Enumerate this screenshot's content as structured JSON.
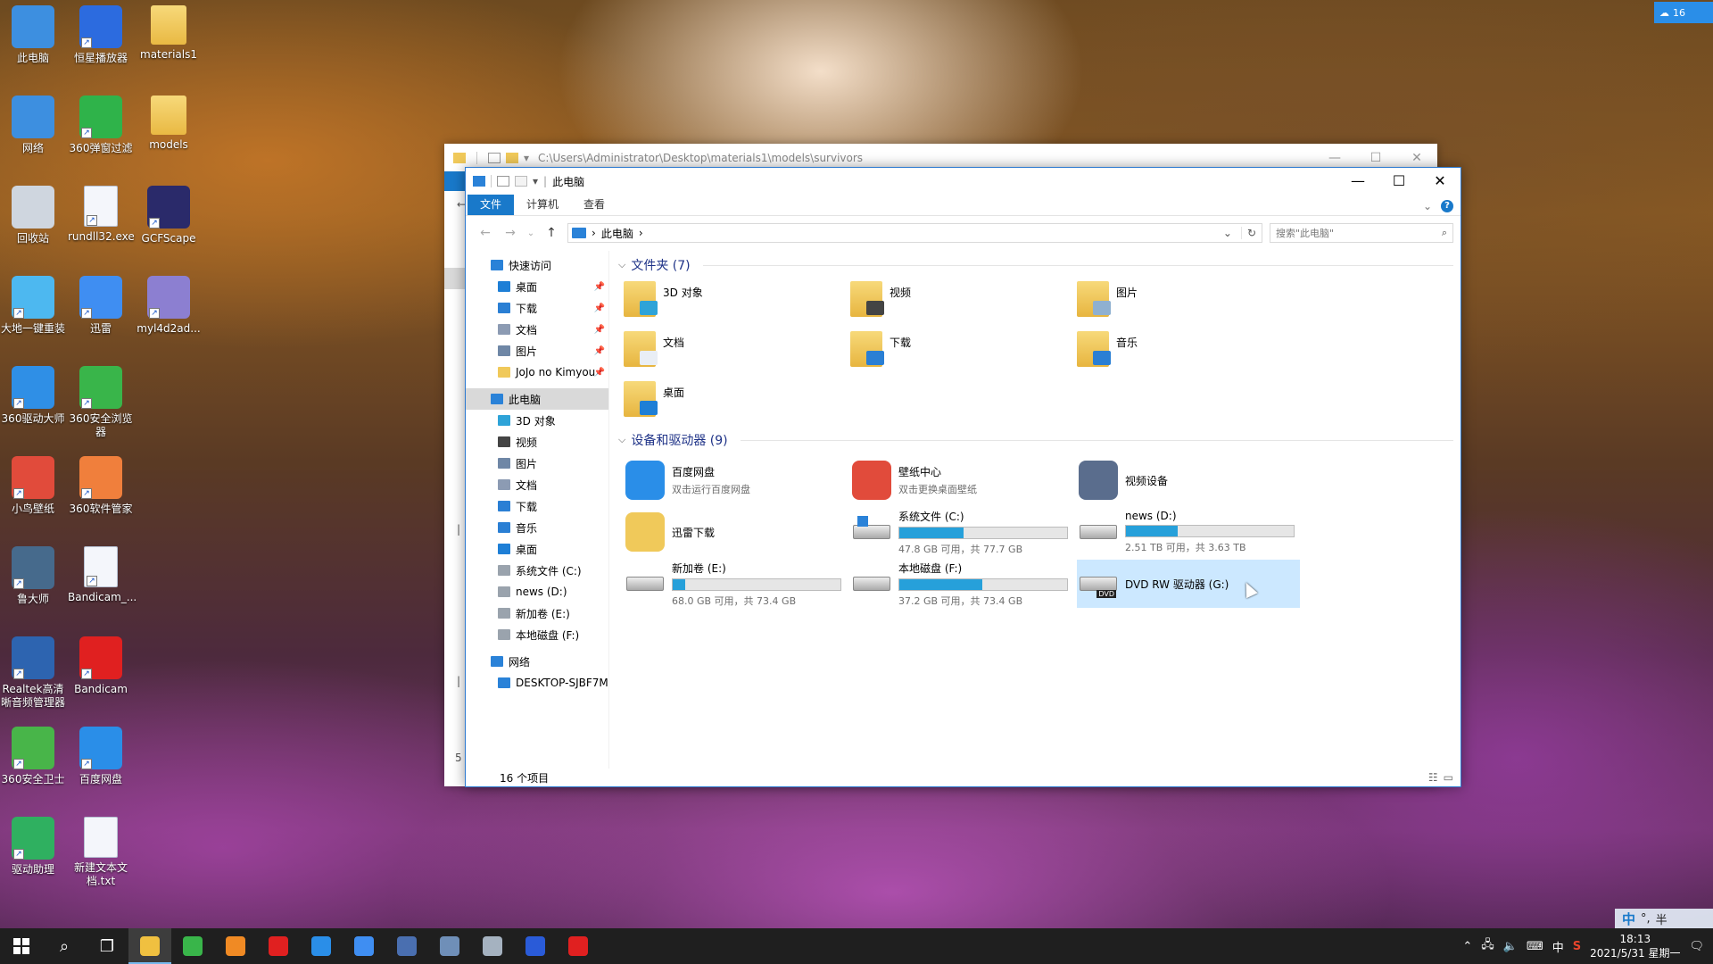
{
  "desktop": {
    "icons": [
      {
        "label": "此电脑",
        "icon": "computer-icon",
        "color": "#3d8fe0"
      },
      {
        "label": "恒星播放器",
        "icon": "player-icon",
        "color": "#2c6bdf"
      },
      {
        "label": "materials1",
        "icon": "folder-icon",
        "color": "#e9b943"
      },
      {
        "label": "网络",
        "icon": "network-icon",
        "color": "#3d8fe0"
      },
      {
        "label": "360弹窗过滤",
        "icon": "popup-filter-icon",
        "color": "#2fb34a"
      },
      {
        "label": "models",
        "icon": "folder-icon",
        "color": "#e9b943"
      },
      {
        "label": "回收站",
        "icon": "recycle-bin-icon",
        "color": "#cfd6df"
      },
      {
        "label": "rundll32.exe",
        "icon": "file-icon",
        "color": "#f4f6fb"
      },
      {
        "label": "GCFScape",
        "icon": "gcfscape-icon",
        "color": "#2a2a6a"
      },
      {
        "label": "大地一键重装",
        "icon": "reinstall-icon",
        "color": "#4db8f0"
      },
      {
        "label": "迅雷",
        "icon": "thunder-icon",
        "color": "#3f8ef2"
      },
      {
        "label": "myl4d2ad...",
        "icon": "archive-icon",
        "color": "#8c7fd1"
      },
      {
        "label": "360驱动大师",
        "icon": "driver-master-icon",
        "color": "#2f8fe6"
      },
      {
        "label": "360安全浏览器",
        "icon": "browser-icon",
        "color": "#39b54a"
      },
      {
        "label": "小鸟壁纸",
        "icon": "wallpaper-icon",
        "color": "#e14b3b"
      },
      {
        "label": "360软件管家",
        "icon": "software-manager-icon",
        "color": "#f07f3c"
      },
      {
        "label": "鲁大师",
        "icon": "ludashi-icon",
        "color": "#466a8c"
      },
      {
        "label": "Bandicam_...",
        "icon": "file-icon",
        "color": "#f4f6fb"
      },
      {
        "label": "Realtek高清晰音频管理器",
        "icon": "audio-icon",
        "color": "#2d64b0"
      },
      {
        "label": "Bandicam",
        "icon": "record-icon",
        "color": "#e02020"
      },
      {
        "label": "360安全卫士",
        "icon": "security-guard-icon",
        "color": "#48b549"
      },
      {
        "label": "百度网盘",
        "icon": "baidu-netdisk-icon",
        "color": "#2a8ee8"
      },
      {
        "label": "驱动助理",
        "icon": "driver-helper-icon",
        "color": "#2fb060"
      },
      {
        "label": "新建文本文档.txt",
        "icon": "text-file-icon",
        "color": "#f4f6fb"
      }
    ]
  },
  "back_window": {
    "path": "C:\\Users\\Administrator\\Desktop\\materials1\\models\\survivors",
    "side_mark": "5"
  },
  "window": {
    "title": "此电脑",
    "minimize": "—",
    "maximize": "☐",
    "close": "✕",
    "ribbon": {
      "file": "文件",
      "computer": "计算机",
      "view": "查看"
    },
    "address": {
      "root_sep": "›",
      "location": "此电脑",
      "trail_sep": "›"
    },
    "search_placeholder": "搜索\"此电脑\"",
    "nav": {
      "quick_access": "快速访问",
      "quick_items": [
        {
          "label": "桌面",
          "color": "#1e7fd6",
          "pinned": "📌"
        },
        {
          "label": "下载",
          "color": "#2a7fd4",
          "pinned": "📌"
        },
        {
          "label": "文档",
          "color": "#8c9bb3",
          "pinned": "📌"
        },
        {
          "label": "图片",
          "color": "#6f87a6",
          "pinned": "📌"
        },
        {
          "label": "JoJo no Kimyou",
          "color": "#f0c95a",
          "pinned": "📌"
        }
      ],
      "this_pc": "此电脑",
      "pc_items": [
        {
          "label": "3D 对象",
          "color": "#2ea3d8"
        },
        {
          "label": "视频",
          "color": "#444444"
        },
        {
          "label": "图片",
          "color": "#6f87a6"
        },
        {
          "label": "文档",
          "color": "#8c9bb3"
        },
        {
          "label": "下载",
          "color": "#2a7fd4"
        },
        {
          "label": "音乐",
          "color": "#2a7fd4"
        },
        {
          "label": "桌面",
          "color": "#1e7fd6"
        },
        {
          "label": "系统文件 (C:)",
          "color": "#9aa3ad"
        },
        {
          "label": "news (D:)",
          "color": "#9aa3ad"
        },
        {
          "label": "新加卷 (E:)",
          "color": "#9aa3ad"
        },
        {
          "label": "本地磁盘 (F:)",
          "color": "#9aa3ad"
        }
      ],
      "network": "网络",
      "network_items": [
        {
          "label": "DESKTOP-SJBF7M",
          "color": "#2a82d8"
        }
      ]
    },
    "folders_header": "文件夹 (7)",
    "folders": [
      {
        "name": "3D 对象",
        "badge": "#2ea3d8"
      },
      {
        "name": "视频",
        "badge": "#444444"
      },
      {
        "name": "图片",
        "badge": "#8fb0d0"
      },
      {
        "name": "文档",
        "badge": "#e9eef5"
      },
      {
        "name": "下载",
        "badge": "#2a7fd4"
      },
      {
        "name": "音乐",
        "badge": "#2a7fd4"
      },
      {
        "name": "桌面",
        "badge": "#1e7fd6"
      }
    ],
    "devices_header": "设备和驱动器 (9)",
    "devices": [
      {
        "name": "百度网盘",
        "sub": "双击运行百度网盘",
        "kind": "app",
        "icon": "baidu-netdisk-icon",
        "color": "#2a8ee8"
      },
      {
        "name": "壁纸中心",
        "sub": "双击更换桌面壁纸",
        "kind": "app",
        "icon": "wallpaper-center-icon",
        "color": "#e14b3b"
      },
      {
        "name": "视频设备",
        "sub": "",
        "kind": "app",
        "icon": "webcam-icon",
        "color": "#5a6d8d"
      },
      {
        "name": "迅雷下载",
        "sub": "",
        "kind": "app",
        "icon": "thunder-download-icon",
        "color": "#f0c95a"
      },
      {
        "name": "系统文件 (C:)",
        "sub": "47.8 GB 可用，共 77.7 GB",
        "kind": "drive",
        "icon": "windows-drive-icon",
        "used": 0.385
      },
      {
        "name": "news (D:)",
        "sub": "2.51 TB 可用，共 3.63 TB",
        "kind": "drive",
        "icon": "drive-icon",
        "used": 0.31
      },
      {
        "name": "新加卷 (E:)",
        "sub": "68.0 GB 可用，共 73.4 GB",
        "kind": "drive",
        "icon": "drive-icon",
        "used": 0.074
      },
      {
        "name": "本地磁盘 (F:)",
        "sub": "37.2 GB 可用，共 73.4 GB",
        "kind": "drive",
        "icon": "drive-icon",
        "used": 0.493
      },
      {
        "name": "DVD RW 驱动器 (G:)",
        "sub": "",
        "kind": "dvd",
        "icon": "dvd-drive-icon",
        "badge": "DVD"
      }
    ],
    "status": "16 个项目"
  },
  "taskbar": {
    "apps": [
      {
        "icon": "file-explorer-icon",
        "color": "#f0c040",
        "active": true
      },
      {
        "icon": "360-browser-icon",
        "color": "#39b54a"
      },
      {
        "icon": "app-a-icon",
        "color": "#f08a24"
      },
      {
        "icon": "app-red-icon",
        "color": "#e02020"
      },
      {
        "icon": "baidu-netdisk-icon",
        "color": "#2a8ee8"
      },
      {
        "icon": "thunder-icon",
        "color": "#3f8ef2"
      },
      {
        "icon": "film-icon",
        "color": "#4a6fb0"
      },
      {
        "icon": "controller-icon",
        "color": "#6f8fb8"
      },
      {
        "icon": "ludashi-icon",
        "color": "#a5b2c0"
      },
      {
        "icon": "video-app-icon",
        "color": "#2a5bd8"
      },
      {
        "icon": "bandicam-icon",
        "color": "#e02020"
      }
    ],
    "tray": {
      "ime": "中",
      "time": "18:13",
      "date": "2021/5/31 星期一"
    }
  },
  "ime_float": {
    "lang": "中",
    "punct": "°,",
    "width": "半"
  },
  "baidu_float": {
    "text": "16"
  }
}
